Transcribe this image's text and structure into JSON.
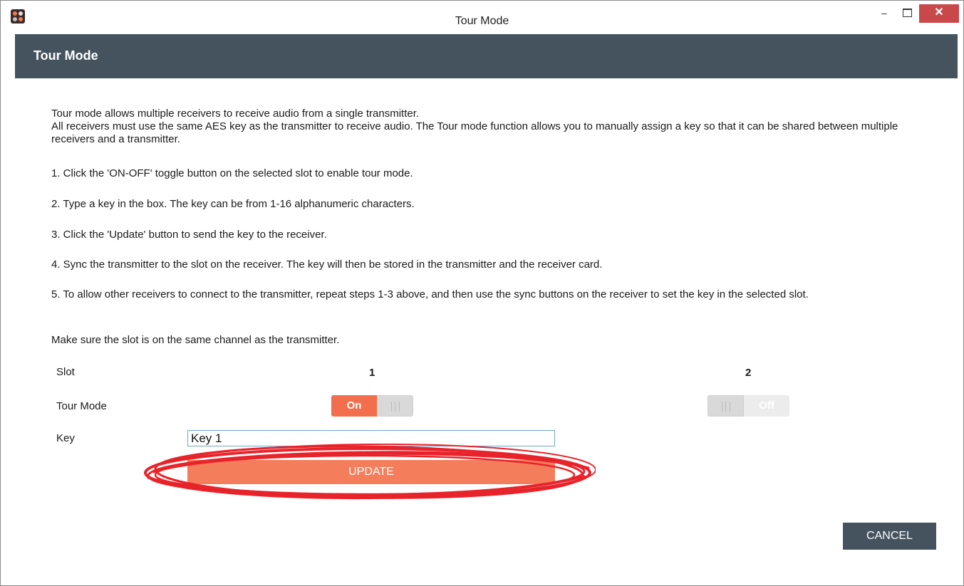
{
  "window": {
    "title": "Tour Mode",
    "controls": {
      "minimize": "–",
      "close": "✕"
    },
    "icons": {
      "app": "app-logo-icon",
      "maximize": "maximize-icon"
    }
  },
  "header": {
    "title": "Tour Mode"
  },
  "instructions": {
    "intro_line1": "Tour mode allows multiple receivers to receive audio from a single transmitter.",
    "intro_line2": "All receivers must use the same AES key as the transmitter to receive audio. The Tour mode function allows you to manually assign a key so that it can be shared between multiple receivers and a transmitter.",
    "step1": "1. Click the 'ON-OFF' toggle button on the selected slot to enable tour mode.",
    "step2": "2. Type a key in the box. The key can be from 1-16 alphanumeric characters.",
    "step3": "3. Click the 'Update' button to send the key to the receiver.",
    "step4": "4. Sync the transmitter to the slot on the receiver. The key will then be stored in the transmitter and the receiver card.",
    "step5": "5. To allow other receivers to connect to the transmitter, repeat steps 1-3 above, and then use the sync buttons on the receiver to set the key in the selected slot.",
    "note": "Make sure the slot is on the same channel as the transmitter."
  },
  "form": {
    "slot_label": "Slot",
    "tour_mode_label": "Tour Mode",
    "key_label": "Key",
    "slots": [
      {
        "number": "1",
        "toggle_text": "On",
        "enabled": true
      },
      {
        "number": "2",
        "toggle_text": "Off",
        "enabled": false
      }
    ],
    "key_value": "Key 1",
    "update_label": "UPDATE"
  },
  "footer": {
    "cancel_label": "CANCEL"
  },
  "colors": {
    "header_bg": "#44535e",
    "accent": "#f26e4d",
    "update_bg": "#f47d5c",
    "close_bg": "#c9494a",
    "annotation": "#e8232a"
  }
}
